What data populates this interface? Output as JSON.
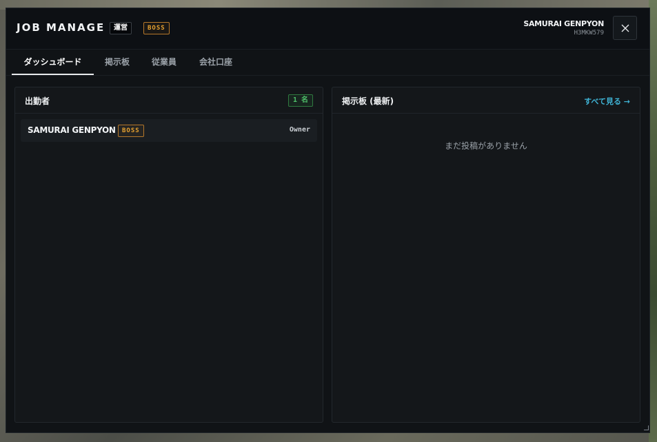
{
  "header": {
    "title": "JOB MANAGE",
    "badge_unei": "運営",
    "badge_boss": "BOSS",
    "user_name": "SAMURAI GENPYON",
    "user_id": "H3MKW579",
    "close_icon": "close-icon"
  },
  "tabs": [
    {
      "label": "ダッシュボード",
      "active": true
    },
    {
      "label": "掲示板",
      "active": false
    },
    {
      "label": "従業員",
      "active": false
    },
    {
      "label": "会社口座",
      "active": false
    }
  ],
  "attendance": {
    "title": "出勤者",
    "count": "1 名",
    "members": [
      {
        "name": "SAMURAI GENPYON",
        "badge": "BOSS",
        "role": "Owner"
      }
    ]
  },
  "board": {
    "title": "掲示板 (最新)",
    "see_all": "すべて見る →",
    "empty": "まだ投稿がありません"
  },
  "colors": {
    "accent_link": "#3fb4d6",
    "boss_badge": "#e7a230",
    "count_badge": "#4fc06a",
    "window_bg": "#101316"
  }
}
